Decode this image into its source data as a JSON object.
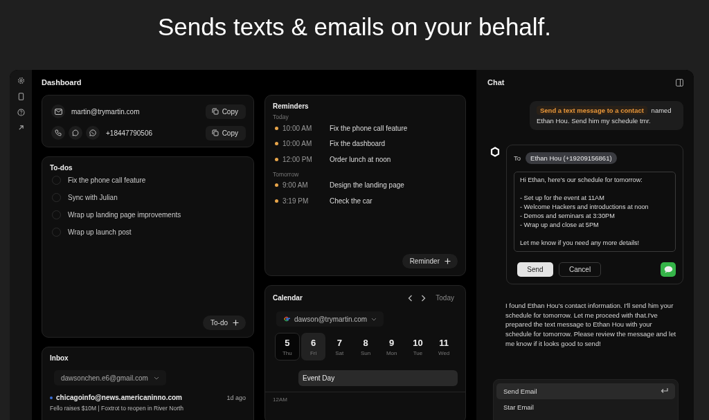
{
  "headline": "Sends texts & emails on your behalf.",
  "dashboard": {
    "title": "Dashboard",
    "contact": {
      "email": "martin@trymartin.com",
      "phone": "+18447790506",
      "copy_buttons": [
        "Copy",
        "Copy"
      ]
    },
    "todos": {
      "title": "To-dos",
      "items": [
        {
          "label": "Fix the phone call feature",
          "checked": false
        },
        {
          "label": "Sync with Julian",
          "checked": false
        },
        {
          "label": "Wrap up landing page improvements",
          "checked": false
        },
        {
          "label": "Wrap up launch post",
          "checked": false
        }
      ],
      "add_button": "To-do"
    },
    "inbox": {
      "title": "Inbox",
      "account": "dawsonchen.e6@gmail.com",
      "emails": [
        {
          "sender": "chicagoinfo@news.americaninno.com",
          "time": "1d ago",
          "subject": "Fello raises $10M | Foxtrot to reopen in River North",
          "unread": true
        }
      ]
    },
    "reminders": {
      "title": "Reminders",
      "groups": [
        {
          "label": "Today",
          "items": [
            {
              "time": "10:00 AM",
              "text": "Fix the phone call feature",
              "color": "#e8a54a"
            },
            {
              "time": "10:00 AM",
              "text": "Fix the dashboard",
              "color": "#e8a54a"
            },
            {
              "time": "12:00 PM",
              "text": "Order lunch at noon",
              "color": "#e8a54a"
            }
          ]
        },
        {
          "label": "Tomorrow",
          "items": [
            {
              "time": "9:00 AM",
              "text": "Design the landing page",
              "color": "#e8a54a"
            },
            {
              "time": "3:19 PM",
              "text": "Check the car",
              "color": "#e8a54a"
            }
          ]
        }
      ],
      "add_button": "Reminder"
    },
    "calendar": {
      "title": "Calendar",
      "today_button": "Today",
      "account": "dawson@trymartin.com",
      "days": [
        {
          "date": "5",
          "weekday": "Thu",
          "today": true,
          "selected": false
        },
        {
          "date": "6",
          "weekday": "Fri",
          "today": false,
          "selected": true
        },
        {
          "date": "7",
          "weekday": "Sat",
          "today": false,
          "selected": false
        },
        {
          "date": "8",
          "weekday": "Sun",
          "today": false,
          "selected": false
        },
        {
          "date": "9",
          "weekday": "Mon",
          "today": false,
          "selected": false
        },
        {
          "date": "10",
          "weekday": "Tue",
          "today": false,
          "selected": false
        },
        {
          "date": "11",
          "weekday": "Wed",
          "today": false,
          "selected": false
        }
      ],
      "all_day_event": "Event Day",
      "hours": [
        "12AM"
      ]
    }
  },
  "chat": {
    "title": "Chat",
    "user_message": {
      "command": "Send a text message to a contact",
      "text": "named Ethan Hou. Send him my schedule tmr."
    },
    "draft": {
      "to_label": "To",
      "recipient": "Ethan Hou (+19209156861)",
      "body": "Hi Ethan, here's our schedule for tomorrow:\n\n- Set up for the event at 11AM\n- Welcome Hackers and introductions at noon\n- Demos and seminars at 3:30PM\n- Wrap up and close at 5PM\n\nLet me know if you need any more details!",
      "buttons": [
        {
          "label": "Send",
          "kind": "primary"
        },
        {
          "label": "Cancel",
          "kind": "secondary"
        }
      ]
    },
    "assistant_message": "I found Ethan Hou's contact information. I'll send him your schedule for tomorrow. Let me proceed with that.I've prepared the text message to Ethan Hou with your schedule for tomorrow. Please review the message and let me know if it looks good to send!",
    "commands": [
      {
        "label": "Send Email",
        "selected": true
      },
      {
        "label": "Star Email",
        "selected": false
      }
    ]
  }
}
